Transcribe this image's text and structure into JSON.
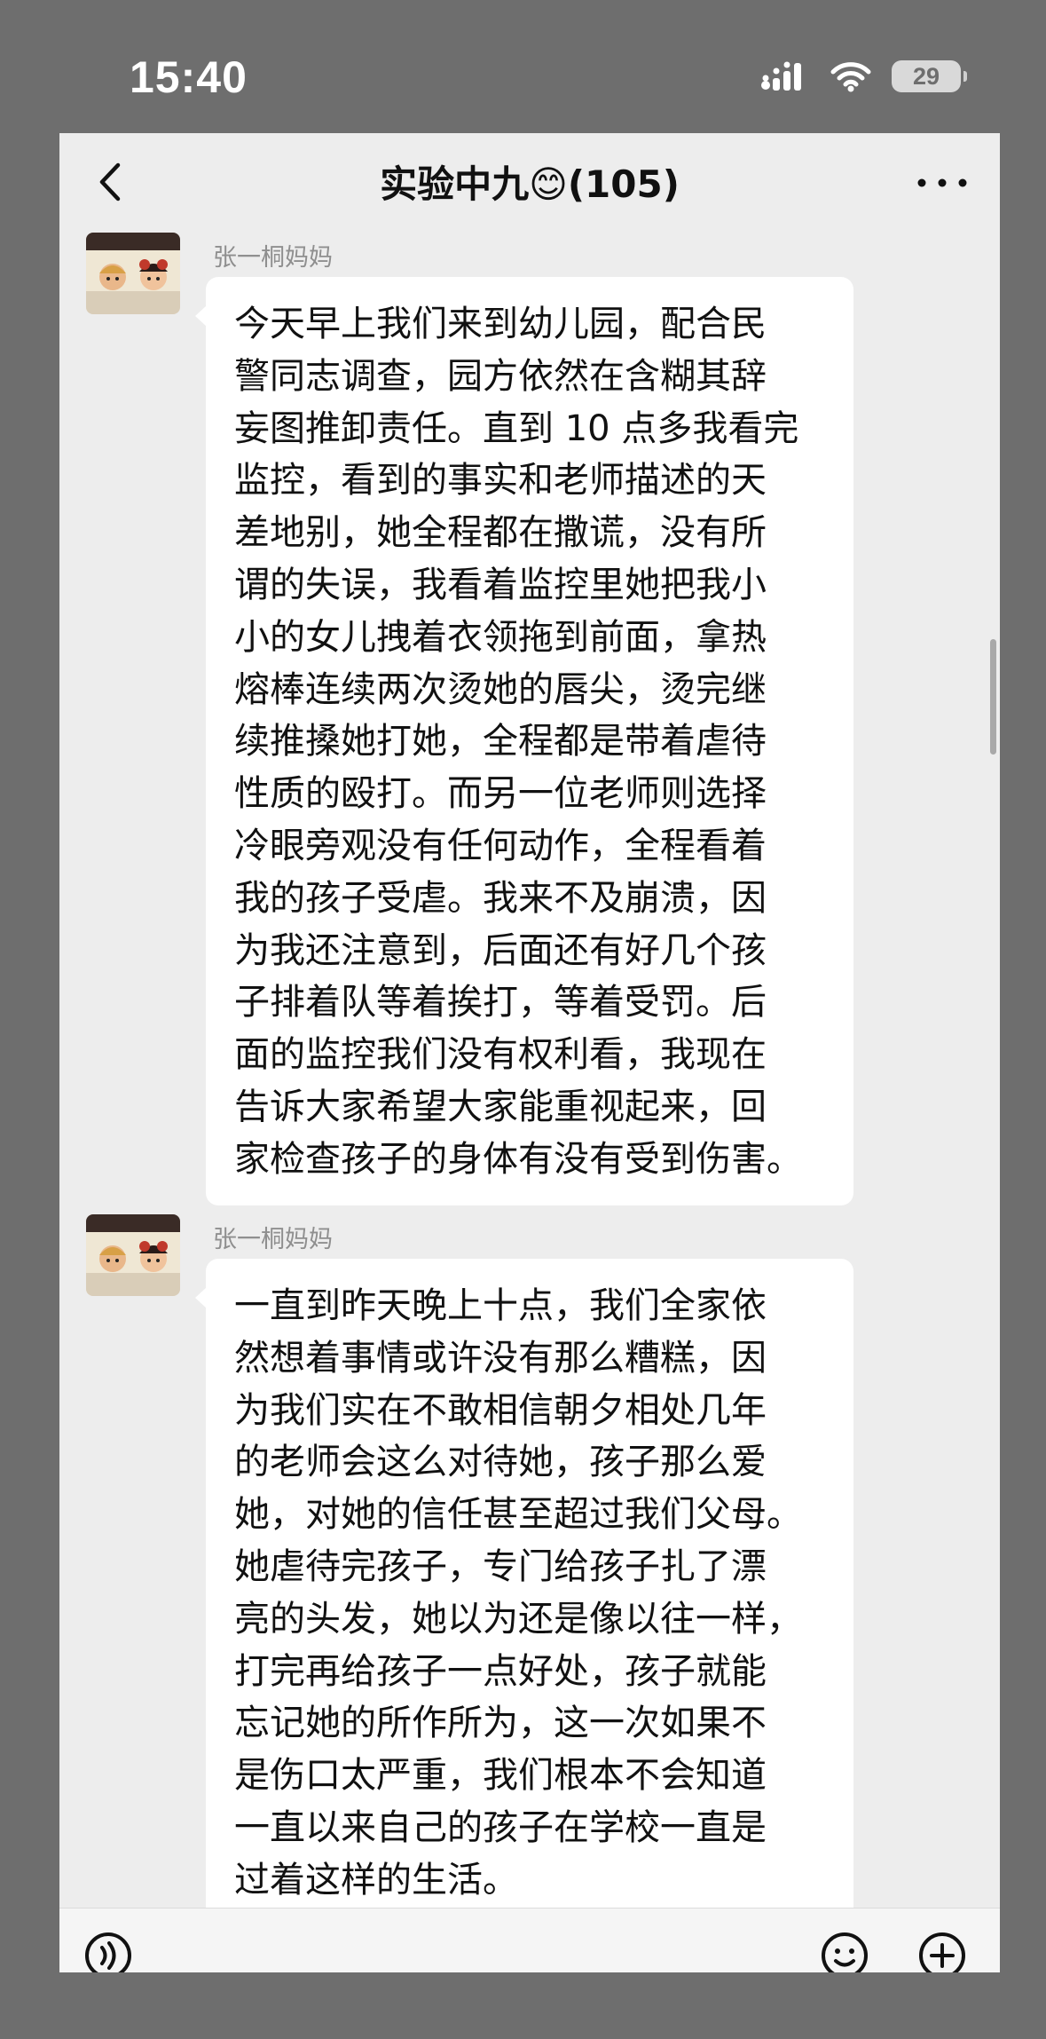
{
  "status_bar": {
    "time": "15:40",
    "battery_level": "29",
    "icons": [
      "signal-icon",
      "wifi-icon",
      "battery-icon"
    ]
  },
  "chat": {
    "title": "实验中九😊(105)",
    "icons": [
      "back-icon",
      "more-icon"
    ]
  },
  "messages": [
    {
      "sender": "张一桐妈妈",
      "lines": [
        "今天早上我们来到幼儿园，配合民",
        "警同志调查，园方依然在含糊其辞",
        "妄图推卸责任。直到 10 点多我看完",
        "监控，看到的事实和老师描述的天",
        "差地别，她全程都在撒谎，没有所",
        "谓的失误，我看着监控里她把我小",
        "小的女儿拽着衣领拖到前面，拿热",
        "熔棒连续两次烫她的唇尖，烫完继",
        "续推搡她打她，全程都是带着虐待",
        "性质的殴打。而另一位老师则选择",
        "冷眼旁观没有任何动作，全程看着",
        "我的孩子受虐。我来不及崩溃，因",
        "为我还注意到，后面还有好几个孩",
        "子排着队等着挨打，等着受罚。后",
        "面的监控我们没有权利看，我现在",
        "告诉大家希望大家能重视起来，回",
        "家检查孩子的身体有没有受到伤害。"
      ]
    },
    {
      "sender": "张一桐妈妈",
      "lines": [
        "一直到昨天晚上十点，我们全家依",
        "然想着事情或许没有那么糟糕，因",
        "为我们实在不敢相信朝夕相处几年",
        "的老师会这么对待她，孩子那么爱",
        "她，对她的信任甚至超过我们父母。",
        "她虐待完孩子，专门给孩子扎了漂",
        "亮的头发，她以为还是像以往一样，",
        "打完再给孩子一点好处，孩子就能",
        "忘记她的所作所为，这一次如果不",
        "是伤口太严重，我们根本不会知道",
        "一直以来自己的孩子在学校一直是",
        "过着这样的生活。"
      ]
    }
  ],
  "input_bar": {
    "icons": [
      "voice-icon",
      "emoji-icon",
      "plus-icon"
    ]
  },
  "colors": {
    "backdrop": "#6e6e6e",
    "screen_bg": "#ededed",
    "bubble_bg": "#ffffff",
    "sender_text": "#8f8f8f"
  }
}
